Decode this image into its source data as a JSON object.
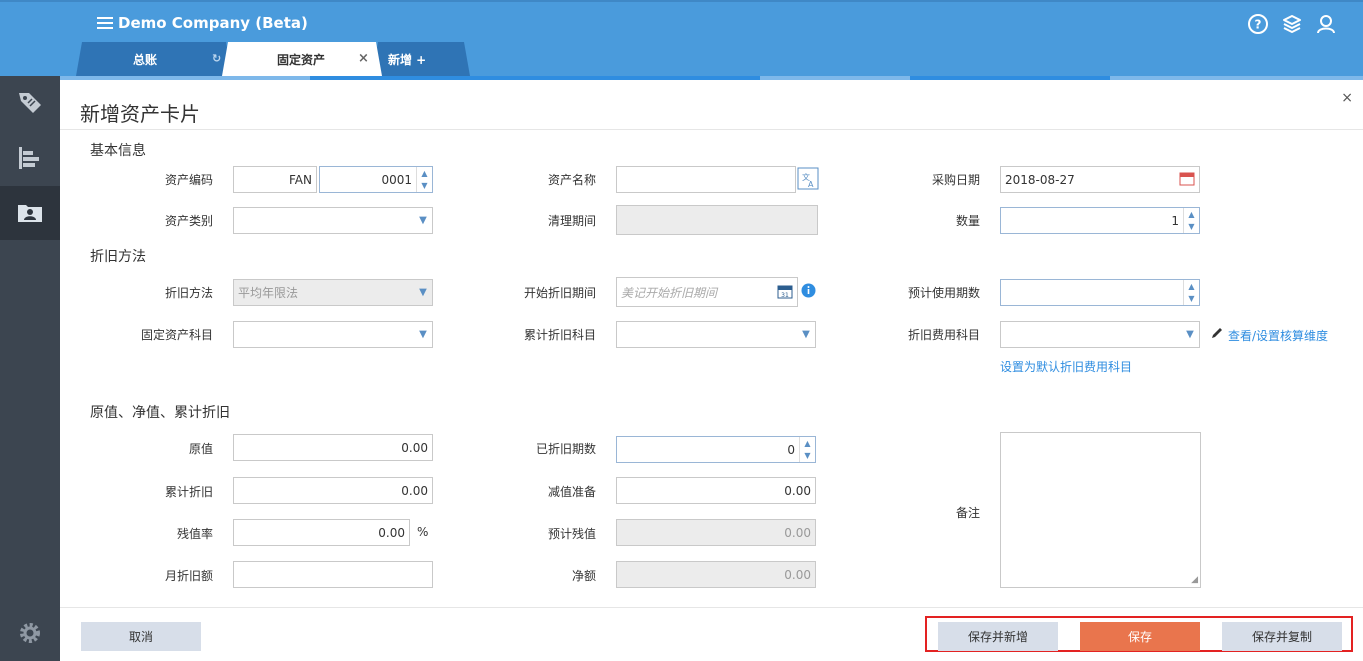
{
  "header": {
    "company": "Demo Company (Beta)",
    "icons": [
      "help-icon",
      "layers-icon",
      "user-icon"
    ]
  },
  "tabs": [
    {
      "label": "总账",
      "icon": "refresh-icon"
    },
    {
      "label": "固定资产",
      "icon": "close-icon"
    },
    {
      "label": "新增 +"
    }
  ],
  "sidebar": {
    "items": [
      "tag-icon",
      "bar-chart-icon",
      "folder-user-icon",
      "gear-icon"
    ]
  },
  "panel": {
    "title": "新增资产卡片",
    "close": "×"
  },
  "sections": {
    "basic": "基本信息",
    "depreciation": "折旧方法",
    "values": "原值、净值、累计折旧"
  },
  "basic": {
    "code_label": "资产编码",
    "code_prefix": "FAN",
    "code_number": "0001",
    "name_label": "资产名称",
    "name_value": "",
    "purchase_label": "采购日期",
    "purchase_value": "2018-08-27",
    "category_label": "资产类别",
    "category_value": "",
    "cleanup_label": "清理期间",
    "cleanup_value": "",
    "qty_label": "数量",
    "qty_value": "1"
  },
  "depreciation": {
    "method_label": "折旧方法",
    "method_value": "平均年限法",
    "start_label": "开始折旧期间",
    "start_placeholder": "美记开始折旧期间",
    "periods_label": "预计使用期数",
    "periods_value": "",
    "fixed_account_label": "固定资产科目",
    "fixed_account_value": "",
    "accum_account_label": "累计折旧科目",
    "accum_account_value": "",
    "expense_account_label": "折旧费用科目",
    "expense_account_value": "",
    "view_link": "查看/设置核算维度",
    "default_link": "设置为默认折旧费用科目"
  },
  "values": {
    "original_label": "原值",
    "original_value": "0.00",
    "depreciated_periods_label": "已折旧期数",
    "depreciated_periods_value": "0",
    "accum_label": "累计折旧",
    "accum_value": "0.00",
    "impairment_label": "减值准备",
    "impairment_value": "0.00",
    "residual_rate_label": "残值率",
    "residual_rate_value": "0.00",
    "residual_rate_unit": "%",
    "est_residual_label": "预计残值",
    "est_residual_value": "0.00",
    "monthly_label": "月折旧额",
    "monthly_value": "",
    "net_label": "净额",
    "net_value": "0.00",
    "remark_label": "备注"
  },
  "footer": {
    "cancel": "取消",
    "save_new": "保存并新增",
    "save": "保存",
    "save_copy": "保存并复制"
  },
  "colors": {
    "header_bg": "#4a9bdc",
    "sidebar_bg": "#3c4550",
    "primary_button": "#e9754d",
    "link": "#2f8de0",
    "highlight": "#e32222"
  }
}
